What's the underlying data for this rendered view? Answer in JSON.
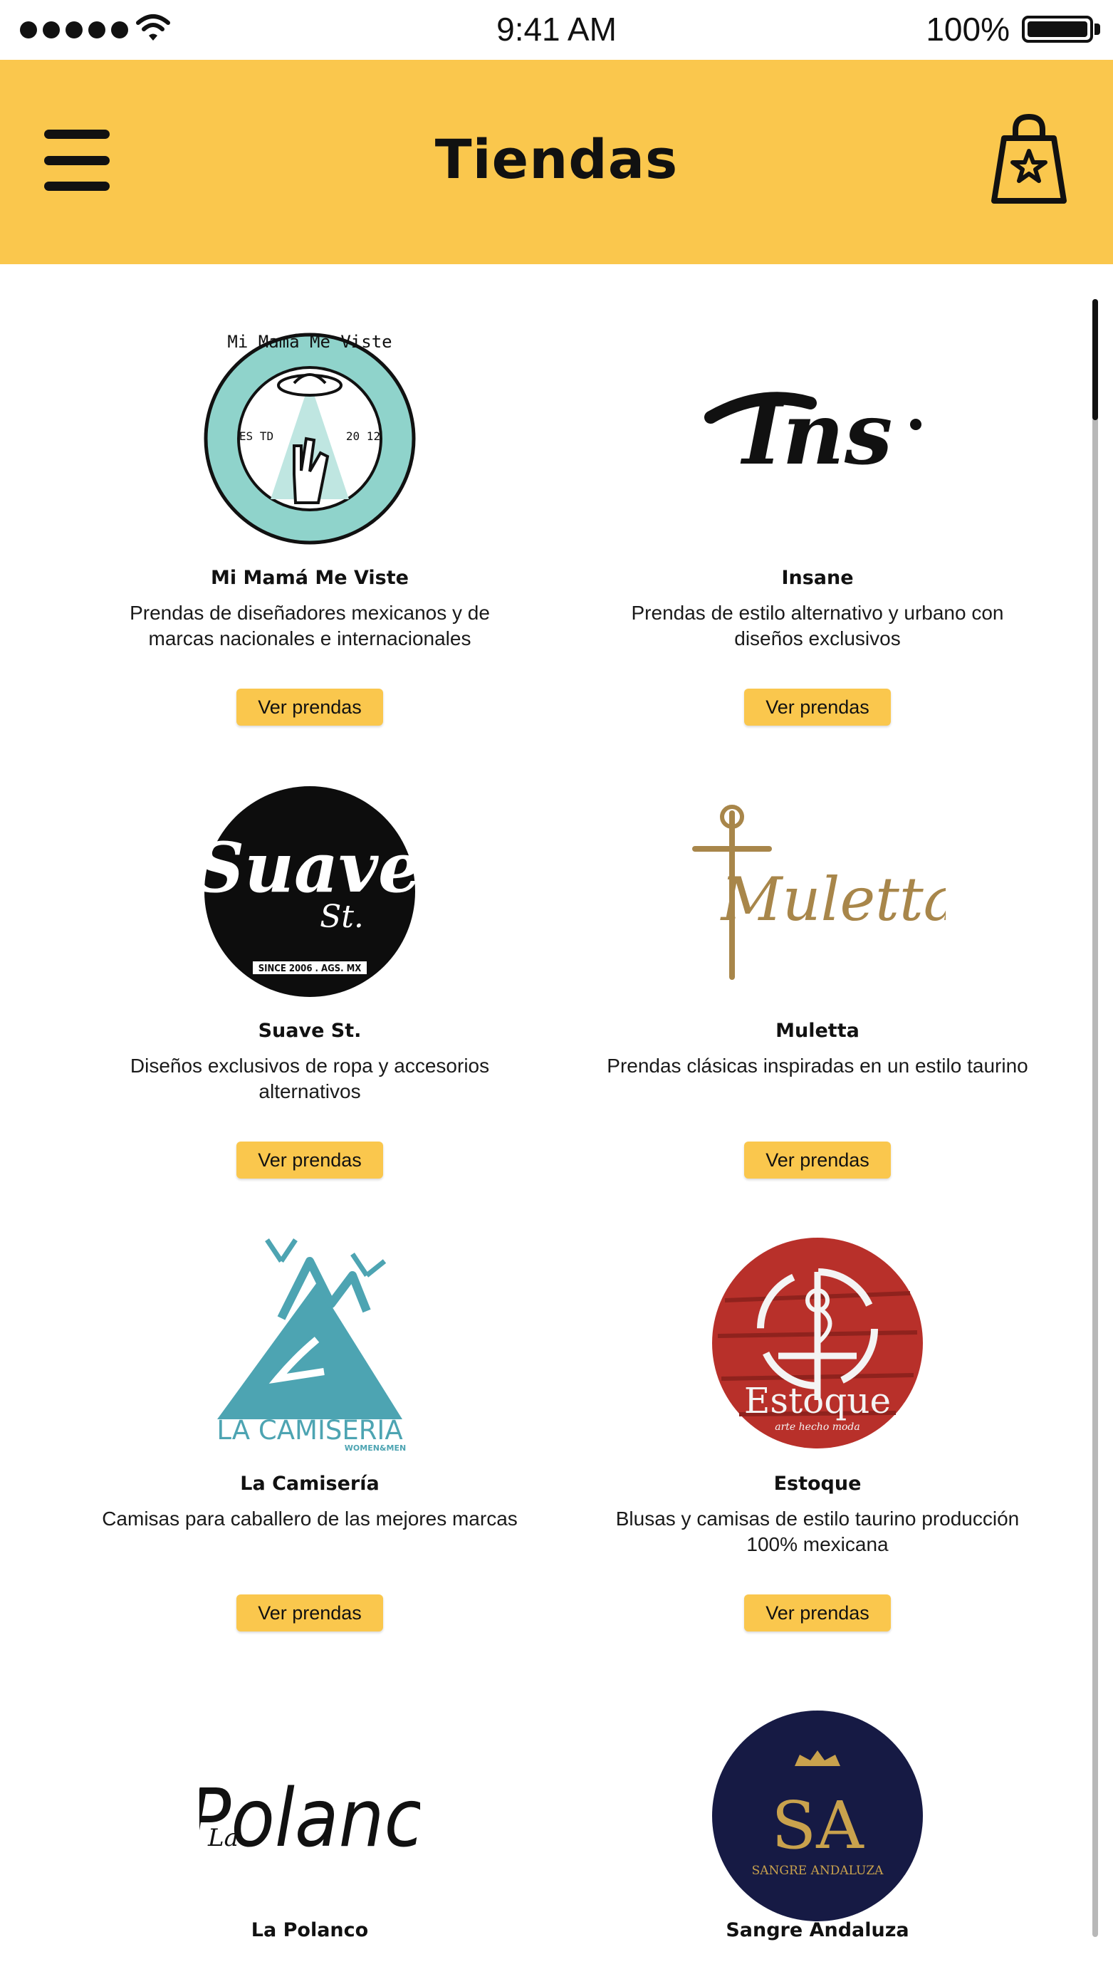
{
  "status_bar": {
    "time": "9:41 AM",
    "battery": "100%"
  },
  "header": {
    "title": "Tiendas"
  },
  "stores": [
    {
      "name": "Mi Mamá Me Viste",
      "description": "Prendas de diseñadores mexicanos y de marcas nacionales e internacionales",
      "button": "Ver prendas",
      "logo_text": "Mi Mamá Me Viste",
      "logo_extra": [
        "ES TD",
        "20 12"
      ]
    },
    {
      "name": "Insane",
      "description": "Prendas de estilo alternativo y urbano con diseños exclusivos",
      "button": "Ver prendas",
      "logo_text": "Ins"
    },
    {
      "name": "Suave St.",
      "description": "Diseños exclusivos de ropa y accesorios alternativos",
      "button": "Ver prendas",
      "logo_text": "Suave",
      "logo_extra": [
        "St.",
        "SINCE 2006 . AGS. MX"
      ]
    },
    {
      "name": "Muletta",
      "description": "Prendas clásicas inspiradas en un estilo taurino",
      "button": "Ver prendas",
      "logo_text": "Muletta."
    },
    {
      "name": "La Camisería",
      "description": "Camisas para caballero de las mejores marcas",
      "button": "Ver prendas",
      "logo_text": "LA CAMISERÍA",
      "logo_extra": [
        "WOMEN&MEN"
      ]
    },
    {
      "name": "Estoque",
      "description": "Blusas y camisas de estilo taurino producción 100% mexicana",
      "button": "Ver prendas",
      "logo_text": "Estoque",
      "logo_extra": [
        "arte hecho moda"
      ]
    },
    {
      "name": "La Polanco",
      "description": "",
      "button": "",
      "logo_text": "Polanco",
      "logo_extra": [
        "La"
      ]
    },
    {
      "name": "Sangre Andaluza",
      "description": "",
      "button": "",
      "logo_text": "SANGRE ANDALUZA",
      "logo_extra": [
        "SA"
      ]
    }
  ],
  "colors": {
    "accent": "#fac74d",
    "estoque_red": "#c0392b",
    "camiseria_teal": "#4da4b2",
    "muletta_gold": "#a8864a",
    "sangre_navy": "#161a44",
    "mmmv_mint": "#8fd3cb"
  },
  "icons": {
    "menu": "hamburger-icon",
    "cart": "shopping-bag-star-icon"
  }
}
